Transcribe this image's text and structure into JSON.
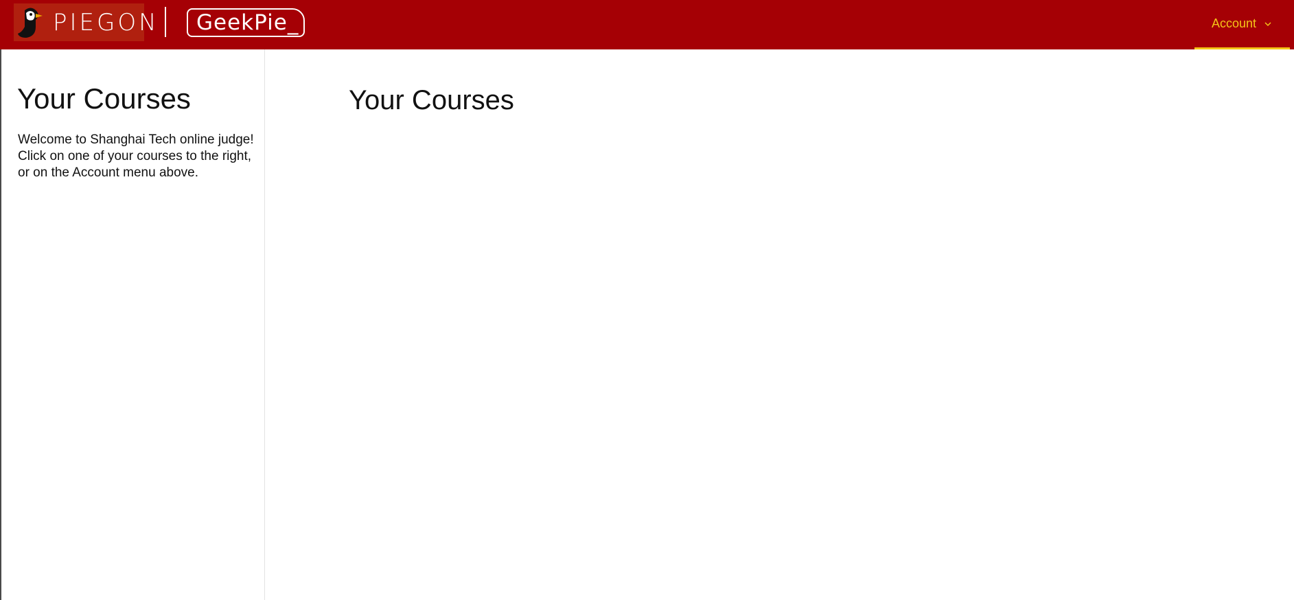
{
  "header": {
    "brand_name": "PIEGON",
    "partner_logo_text": "GeekPie_",
    "account_label": "Account",
    "account_icon": "chevron-down-icon"
  },
  "sidebar": {
    "title": "Your Courses",
    "welcome_text": "Welcome to Shanghai Tech online judge! Click on one of your courses to the right, or on the Account menu above."
  },
  "main": {
    "title": "Your Courses",
    "courses": []
  },
  "colors": {
    "header_background": "#a50005",
    "accent": "#f5c518",
    "logo_background": "#b0200f"
  }
}
